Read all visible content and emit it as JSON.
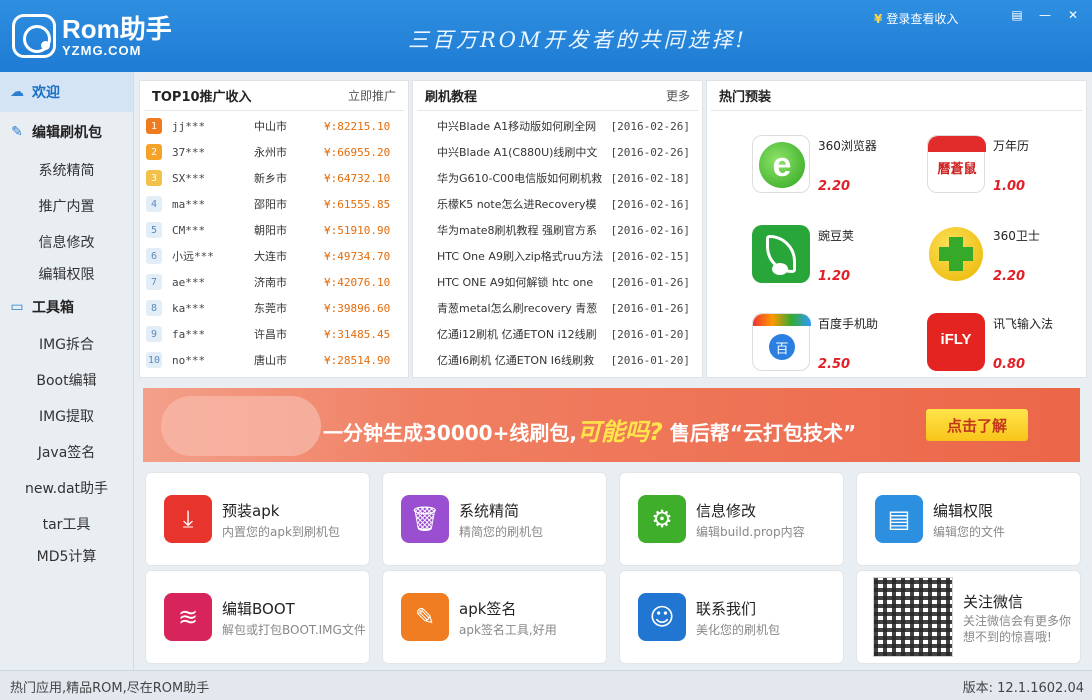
{
  "header": {
    "logo_main": "Rom助手",
    "logo_sub": "YZMG.COM",
    "slogan": "三百万ROM开发者的共同选择!",
    "login_currency": "¥",
    "login_label": "登录查看收入"
  },
  "sidebar": {
    "welcome": "欢迎",
    "edit_pack": "编辑刷机包",
    "edit_items": [
      "系统精简",
      "推广内置",
      "信息修改",
      "编辑权限"
    ],
    "toolbox": "工具箱",
    "tool_items": [
      "IMG拆合",
      "Boot编辑",
      "IMG提取",
      "Java签名",
      "new.dat助手",
      "tar工具",
      "MD5计算"
    ]
  },
  "top10": {
    "title": "TOP10推广收入",
    "action": "立即推广",
    "rows": [
      {
        "rank": "1",
        "user": "jj***",
        "city": "中山市",
        "value": "¥:82215.10"
      },
      {
        "rank": "2",
        "user": "37***",
        "city": "永州市",
        "value": "¥:66955.20"
      },
      {
        "rank": "3",
        "user": "SX***",
        "city": "新乡市",
        "value": "¥:64732.10"
      },
      {
        "rank": "4",
        "user": "ma***",
        "city": "邵阳市",
        "value": "¥:61555.85"
      },
      {
        "rank": "5",
        "user": "CM***",
        "city": "朝阳市",
        "value": "¥:51910.90"
      },
      {
        "rank": "6",
        "user": "小远***",
        "city": "大连市",
        "value": "¥:49734.70"
      },
      {
        "rank": "7",
        "user": "ae***",
        "city": "济南市",
        "value": "¥:42076.10"
      },
      {
        "rank": "8",
        "user": "ka***",
        "city": "东莞市",
        "value": "¥:39896.60"
      },
      {
        "rank": "9",
        "user": "fa***",
        "city": "许昌市",
        "value": "¥:31485.45"
      },
      {
        "rank": "10",
        "user": "no***",
        "city": "唐山市",
        "value": "¥:28514.90"
      }
    ]
  },
  "tutorial": {
    "title": "刷机教程",
    "more": "更多",
    "rows": [
      {
        "title": "中兴Blade A1移动版如何刷全网",
        "date": "[2016-02-26]"
      },
      {
        "title": "中兴Blade A1(C880U)线刷中文",
        "date": "[2016-02-26]"
      },
      {
        "title": "华为G610-C00电信版如何刷机救",
        "date": "[2016-02-18]"
      },
      {
        "title": "乐檬K5 note怎么进Recovery模",
        "date": "[2016-02-16]"
      },
      {
        "title": "华为mate8刷机教程 强刷官方系",
        "date": "[2016-02-16]"
      },
      {
        "title": "HTC One A9刷入zip格式ruu方法",
        "date": "[2016-02-15]"
      },
      {
        "title": "HTC ONE A9如何解锁 htc one",
        "date": "[2016-01-26]"
      },
      {
        "title": "青葱metal怎么刷recovery 青葱",
        "date": "[2016-01-26]"
      },
      {
        "title": "亿通i12刷机 亿通ETON i12线刷",
        "date": "[2016-01-20]"
      },
      {
        "title": "亿通I6刷机 亿通ETON I6线刷救",
        "date": "[2016-01-20]"
      }
    ]
  },
  "hot": {
    "title": "热门预装",
    "apps": [
      {
        "name": "360浏览器",
        "score": "2.20",
        "icon": "360-browser-icon"
      },
      {
        "name": "万年历",
        "score": "1.00",
        "icon": "calendar-icon",
        "glyph": "曆蒼鼠"
      },
      {
        "name": "豌豆荚",
        "score": "1.20",
        "icon": "wandoujia-icon"
      },
      {
        "name": "360卫士",
        "score": "2.20",
        "icon": "360-security-icon"
      },
      {
        "name": "百度手机助",
        "score": "2.50",
        "icon": "baidu-helper-icon",
        "glyph": "百"
      },
      {
        "name": "讯飞输入法",
        "score": "0.80",
        "icon": "iflytek-icon",
        "glyph": "iFLY"
      }
    ]
  },
  "banner": {
    "part1": "一分钟生成30000+线刷包,",
    "highlight": "可能吗?",
    "part2": " 售后帮“云打包技术”",
    "button": "点击了解"
  },
  "tiles": [
    {
      "title": "预装apk",
      "desc": "内置您的apk到刷机包",
      "color": "#e7352e",
      "icon": "download-icon",
      "glyph": "⤓"
    },
    {
      "title": "系统精简",
      "desc": "精简您的刷机包",
      "color": "#9a4fd0",
      "icon": "trash-icon",
      "glyph": "🗑"
    },
    {
      "title": "信息修改",
      "desc": "编辑build.prop内容",
      "color": "#3fae2a",
      "icon": "gear-icon",
      "glyph": "⚙"
    },
    {
      "title": "编辑权限",
      "desc": "编辑您的文件",
      "color": "#2d8fe0",
      "icon": "document-icon",
      "glyph": "▤"
    },
    {
      "title": "编辑BOOT",
      "desc": "解包或打包BOOT.IMG文件",
      "color": "#d7245a",
      "icon": "layers-icon",
      "glyph": "≋"
    },
    {
      "title": "apk签名",
      "desc": "apk签名工具,好用",
      "color": "#f07d21",
      "icon": "pencil-icon",
      "glyph": "✎"
    },
    {
      "title": "联系我们",
      "desc": "美化您的刷机包",
      "color": "#2176d2",
      "icon": "contact-icon",
      "glyph": "☺"
    },
    {
      "title": "关注微信",
      "desc": "关注微信会有更多你想不到的惊喜哦!",
      "color": "#ffffff",
      "icon": "qr-code-icon",
      "glyph": ""
    }
  ],
  "status": {
    "left": "热门应用,精品ROM,尽在ROM助手",
    "version_label": "版本:",
    "version": "12.1.1602.04"
  }
}
